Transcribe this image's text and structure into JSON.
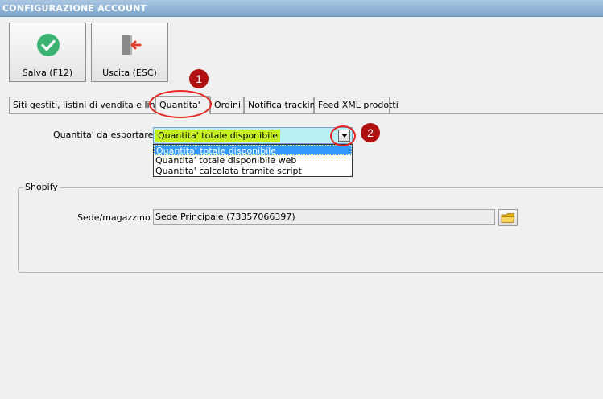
{
  "window": {
    "title": "CONFIGURAZIONE ACCOUNT"
  },
  "toolbar": {
    "save_label": "Salva (F12)",
    "exit_label": "Uscita (ESC)"
  },
  "callouts": [
    "1",
    "2"
  ],
  "tabs": [
    {
      "label": "Siti gestiti, listini di vendita e lingue"
    },
    {
      "label": "Quantita'"
    },
    {
      "label": "Ordini"
    },
    {
      "label": "Notifica tracking"
    },
    {
      "label": "Feed XML prodotti"
    }
  ],
  "active_tab": "Quantita'",
  "quantity": {
    "label": "Quantita' da esportare :",
    "selected": "Quantita' totale disponibile",
    "options": [
      "Quantita' totale disponibile",
      "Quantita' totale disponibile web",
      "Quantita' calcolata tramite script"
    ]
  },
  "shopify": {
    "group_title": "Shopify",
    "location_label": "Sede/magazzino :",
    "location_value": "Sede Principale (73357066397)"
  },
  "colors": {
    "combo_bg": "#b9f0f4",
    "combo_highlight": "#c4f01f",
    "selection": "#3399ff",
    "callout": "#b01010",
    "annotation": "#e8231f",
    "save_icon": "#3cb371",
    "exit_icon": "#e0402a"
  },
  "icons": {
    "save": "check-circle-icon",
    "exit": "door-exit-icon",
    "dropdown": "chevron-down-icon",
    "browse": "folder-icon"
  }
}
